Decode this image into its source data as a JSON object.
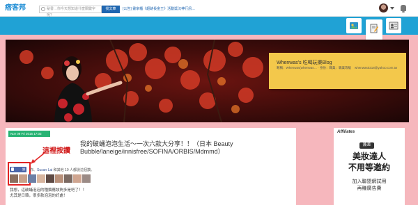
{
  "topbar": {
    "logo": "痞客邦",
    "search_placeholder": "秘書→你今天想知道什麼關鍵字呢？",
    "search_button": "找文章",
    "ticker": "[公告] 畫家櫃《超跡長金王》活動獎沉神行訊…"
  },
  "tabs": [
    {
      "icon": "photo-album-icon"
    },
    {
      "icon": "blog-editor-icon",
      "active": true
    },
    {
      "icon": "profile-card-icon"
    }
  ],
  "blog_card": {
    "title": "Whenwas's 吃喝玩樂Blog",
    "info": "暱稱：Whenwas(whenwas… · 身份：職業：職業等級",
    "email": "whenwas0218@yahoo.com.tw"
  },
  "post": {
    "date": "Nov 09 Fri 2015 17:03",
    "title": "我的破蛹泡泡生活～一次六款大分享！！（日本 Beauty Bubble/laneige/innisfree/SOFINA/ORBIS/Mdmmd）",
    "annotation": "這裡按讚",
    "like_button": "讚",
    "like_text_prefix": "你、",
    "like_text_name": "Susan Lai",
    "like_text_suffix": " 和其他 19 人都說這個讚。",
    "excerpt_line1": "我想，這破蛹泡泡的種類應該夠多是吧了！！",
    "excerpt_line2": "尤其是日韓，很多款泡泡的好處！"
  },
  "ad": {
    "brand": "Affiliates",
    "badge": "兼差",
    "line1": "美妝達人",
    "line2": "不用等邀約",
    "sub1": "加入聯盟網試用",
    "sub2": "再賺廣告費"
  },
  "colors": {
    "brand_blue": "#20a2d5",
    "page_pink": "#f6b7bd",
    "card_yellow": "#f3c84b",
    "date_green": "#27b373",
    "annotation_red": "#e12424"
  }
}
